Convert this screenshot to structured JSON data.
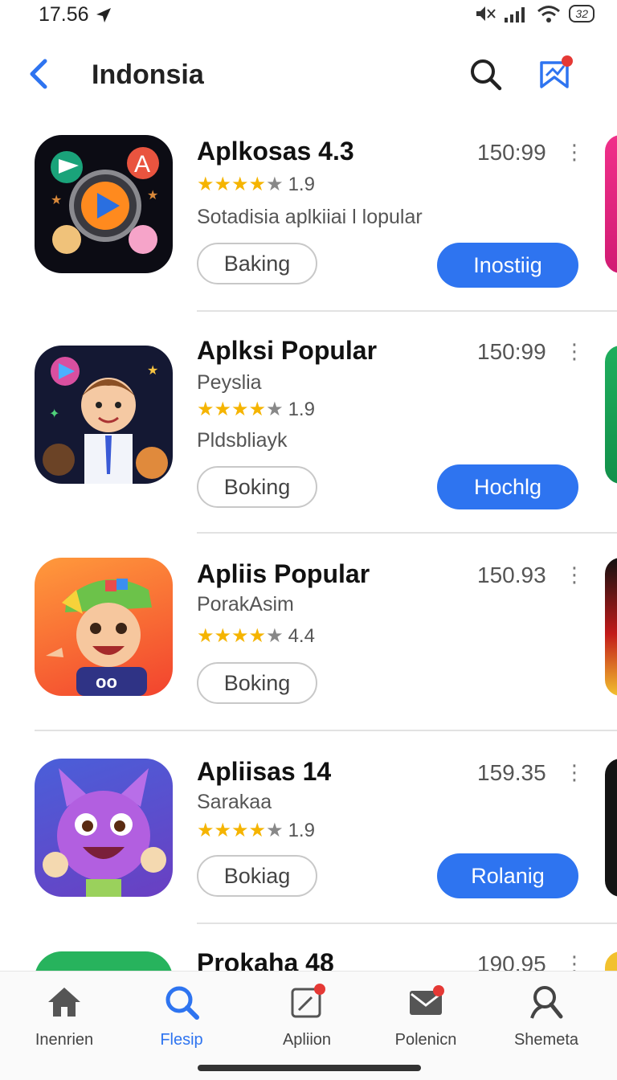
{
  "status": {
    "time": "17.56",
    "battery": "32"
  },
  "header": {
    "title": "Indonsia"
  },
  "apps": [
    {
      "name": "Aplkosas 4.3",
      "size": "150:99",
      "subtitle": "",
      "rating": "1.9",
      "stars": 4,
      "description": "Sotadisia aplkiiai l lopular",
      "secondary_label": "Baking",
      "primary_label": "Inostiig"
    },
    {
      "name": "Aplksi Popular",
      "size": "150:99",
      "subtitle": "Peyslia",
      "rating": "1.9",
      "stars": 4,
      "description": "Pldsbliayk",
      "secondary_label": "Boking",
      "primary_label": "Hochlg"
    },
    {
      "name": "Apliis Popular",
      "size": "150.93",
      "subtitle": "PorakAsim",
      "rating": "4.4",
      "stars": 4,
      "description": "",
      "secondary_label": "Boking",
      "primary_label": ""
    },
    {
      "name": "Apliisas 14",
      "size": "159.35",
      "subtitle": "Sarakaa",
      "rating": "1.9",
      "stars": 4,
      "description": "",
      "secondary_label": "Bokiag",
      "primary_label": "Rolanig"
    },
    {
      "name": "Prokaha 48",
      "size": "190.95",
      "subtitle": "",
      "rating": "",
      "stars": 0,
      "description": "",
      "secondary_label": "",
      "primary_label": ""
    }
  ],
  "more_icon": "⋮",
  "nav": [
    {
      "label": "Inenrien",
      "icon": "home-icon"
    },
    {
      "label": "Flesip",
      "icon": "search-icon",
      "active": true
    },
    {
      "label": "Apliion",
      "icon": "edit-icon"
    },
    {
      "label": "Polenicn",
      "icon": "mail-icon"
    },
    {
      "label": "Shemeta",
      "icon": "profile-icon"
    }
  ],
  "colors": {
    "accent": "#2e74f0",
    "star": "#f5b400",
    "badge": "#e53935"
  }
}
